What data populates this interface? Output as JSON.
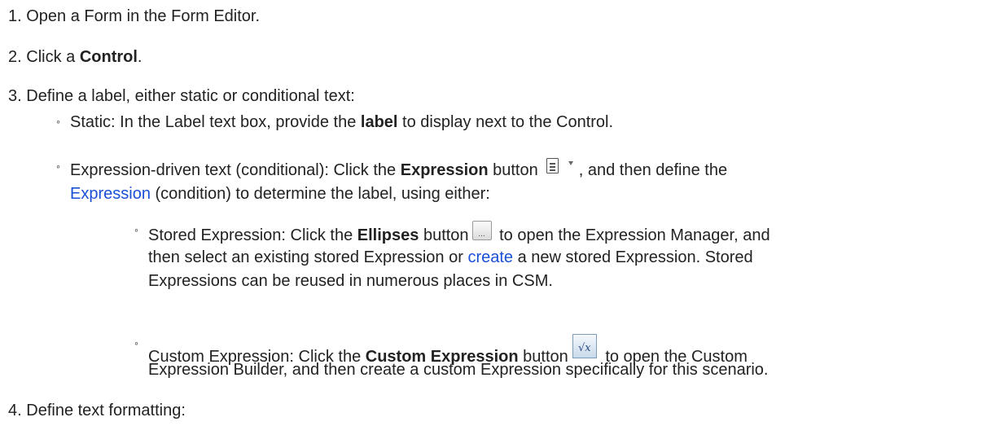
{
  "steps": {
    "s1": {
      "num": "1.",
      "text": "Open a Form in the Form Editor."
    },
    "s2": {
      "num": "2.",
      "pre": "Click a ",
      "bold": "Control",
      "post": "."
    },
    "s3": {
      "num": "3.",
      "text": "Define a label, either static or conditional text:"
    },
    "s4": {
      "num": "4.",
      "text": "Define text formatting:"
    }
  },
  "bullets": {
    "glyph": "◦",
    "static": {
      "pre": "Static: In the Label text box, provide the ",
      "bold": "label",
      "post": " to display next to the Control."
    },
    "expression": {
      "pre": "Expression-driven text (conditional): Click the ",
      "bold": "Expression",
      "mid": " button",
      "post": ", and then define the",
      "link": "Expression",
      "line2_post": " (condition) to determine the label, using either:"
    },
    "stored": {
      "pre": "Stored Expression: Click the ",
      "bold": "Ellipses",
      "mid": " button",
      "post": " to open the Expression Manager, and",
      "line2_pre": "then select an existing stored Expression or ",
      "link": "create",
      "line2_post": " a new stored Expression. Stored",
      "line3": "Expressions can be reused in numerous places in CSM."
    },
    "custom": {
      "pre": "Custom Expression: Click the ",
      "bold": "Custom Expression",
      "mid": " button",
      "post": " to open the Custom",
      "line2": "Expression Builder, and then create a custom Expression specifically for this scenario."
    }
  },
  "icons": {
    "ellipses_text": "...",
    "fx_text": "√x"
  },
  "colors": {
    "link": "#1a4fd6",
    "text": "#222222"
  }
}
